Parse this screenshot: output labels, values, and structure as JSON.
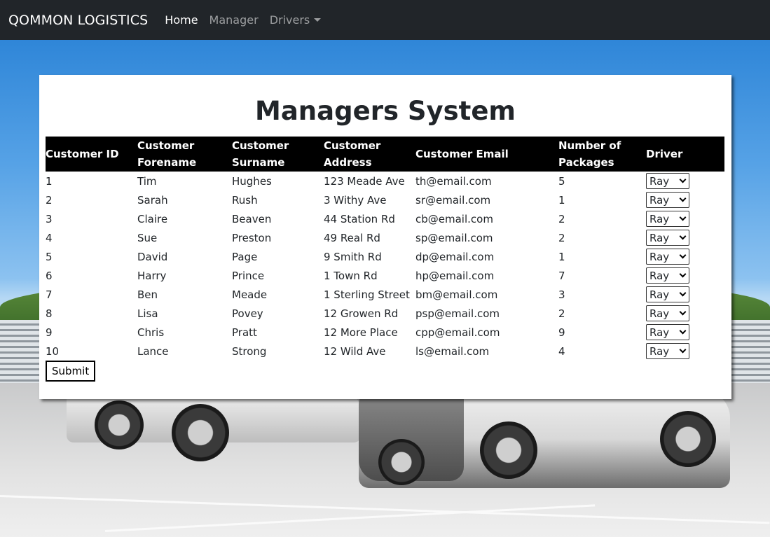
{
  "navbar": {
    "brand": "QOMMON LOGISTICS",
    "links": [
      {
        "label": "Home"
      },
      {
        "label": "Manager"
      },
      {
        "label": "Drivers"
      }
    ]
  },
  "page": {
    "title": "Managers System",
    "submit_label": "Submit"
  },
  "table": {
    "headers": [
      "Customer ID",
      "Customer Forename",
      "Customer Surname",
      "Customer Address",
      "Customer Email",
      "Number of Packages",
      "Driver"
    ],
    "rows": [
      {
        "id": "1",
        "forename": "Tim",
        "surname": "Hughes",
        "address": "123 Meade Ave",
        "email": "th@email.com",
        "packages": "5",
        "driver": "Ray"
      },
      {
        "id": "2",
        "forename": "Sarah",
        "surname": "Rush",
        "address": "3 Withy Ave",
        "email": "sr@email.com",
        "packages": "1",
        "driver": "Ray"
      },
      {
        "id": "3",
        "forename": "Claire",
        "surname": "Beaven",
        "address": "44 Station Rd",
        "email": "cb@email.com",
        "packages": "2",
        "driver": "Ray"
      },
      {
        "id": "4",
        "forename": "Sue",
        "surname": "Preston",
        "address": "49 Real Rd",
        "email": "sp@email.com",
        "packages": "2",
        "driver": "Ray"
      },
      {
        "id": "5",
        "forename": "David",
        "surname": "Page",
        "address": "9 Smith Rd",
        "email": "dp@email.com",
        "packages": "1",
        "driver": "Ray"
      },
      {
        "id": "6",
        "forename": "Harry",
        "surname": "Prince",
        "address": "1 Town Rd",
        "email": "hp@email.com",
        "packages": "7",
        "driver": "Ray"
      },
      {
        "id": "7",
        "forename": "Ben",
        "surname": "Meade",
        "address": "1 Sterling Street",
        "email": "bm@email.com",
        "packages": "3",
        "driver": "Ray"
      },
      {
        "id": "8",
        "forename": "Lisa",
        "surname": "Povey",
        "address": "12 Growen Rd",
        "email": "psp@email.com",
        "packages": "2",
        "driver": "Ray"
      },
      {
        "id": "9",
        "forename": "Chris",
        "surname": "Pratt",
        "address": "12 More Place",
        "email": "cpp@email.com",
        "packages": "9",
        "driver": "Ray"
      },
      {
        "id": "10",
        "forename": "Lance",
        "surname": "Strong",
        "address": "12 Wild Ave",
        "email": "ls@email.com",
        "packages": "4",
        "driver": "Ray"
      }
    ]
  }
}
